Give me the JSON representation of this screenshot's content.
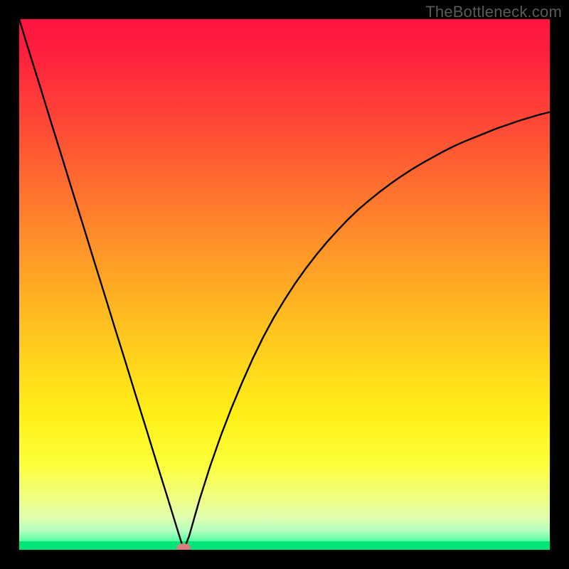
{
  "watermark": "TheBottleneck.com",
  "chart_data": {
    "type": "line",
    "title": "",
    "xlabel": "",
    "ylabel": "",
    "xlim": [
      0,
      100
    ],
    "ylim": [
      0,
      100
    ],
    "x": [
      0,
      2,
      4,
      6,
      8,
      10,
      12,
      14,
      16,
      18,
      20,
      22,
      24,
      26,
      28,
      30,
      31,
      32,
      33,
      34,
      36,
      38,
      40,
      42,
      44,
      46,
      48,
      50,
      52,
      54,
      56,
      58,
      60,
      62,
      64,
      66,
      68,
      70,
      72,
      74,
      76,
      78,
      80,
      82,
      84,
      86,
      88,
      90,
      92,
      94,
      96,
      98,
      100
    ],
    "values": [
      100,
      93.5,
      87.1,
      80.6,
      74.2,
      67.7,
      61.3,
      54.8,
      48.4,
      41.9,
      35.5,
      29.0,
      22.6,
      16.1,
      9.7,
      3.2,
      0.0,
      2.5,
      6.0,
      9.5,
      15.8,
      21.5,
      26.7,
      31.5,
      36.0,
      40.1,
      43.8,
      47.1,
      50.2,
      53.0,
      55.6,
      58.0,
      60.2,
      62.3,
      64.2,
      65.9,
      67.5,
      69.0,
      70.4,
      71.7,
      72.9,
      74.0,
      75.1,
      76.1,
      77.0,
      77.8,
      78.6,
      79.4,
      80.1,
      80.8,
      81.4,
      82.0,
      82.5
    ],
    "marker": {
      "x": 31,
      "y": 0
    },
    "gradient_stops": [
      {
        "offset": 0.0,
        "color": "#ff1440"
      },
      {
        "offset": 0.06,
        "color": "#ff1e3e"
      },
      {
        "offset": 0.15,
        "color": "#ff3a39"
      },
      {
        "offset": 0.25,
        "color": "#ff5a33"
      },
      {
        "offset": 0.35,
        "color": "#ff7a2d"
      },
      {
        "offset": 0.45,
        "color": "#ff9a27"
      },
      {
        "offset": 0.55,
        "color": "#ffb921"
      },
      {
        "offset": 0.65,
        "color": "#ffd61c"
      },
      {
        "offset": 0.75,
        "color": "#fff018"
      },
      {
        "offset": 0.84,
        "color": "#fcff3a"
      },
      {
        "offset": 0.9,
        "color": "#f0ff80"
      },
      {
        "offset": 0.94,
        "color": "#e0ffb0"
      },
      {
        "offset": 0.965,
        "color": "#b0ffc0"
      },
      {
        "offset": 0.985,
        "color": "#50ffa0"
      },
      {
        "offset": 1.0,
        "color": "#00e47a"
      }
    ],
    "green_bar": {
      "y0": 0.0,
      "y1": 1.6,
      "color": "#00e47a"
    }
  }
}
